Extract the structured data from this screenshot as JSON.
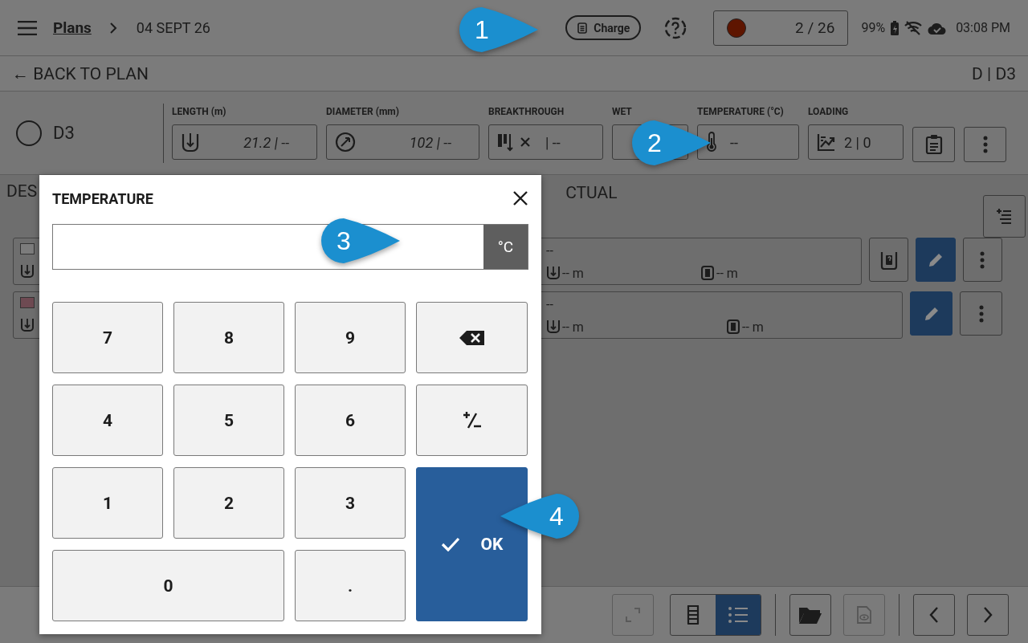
{
  "top_bar": {
    "breadcrumb": "Plans",
    "date": "04 SEPT 26",
    "charge_button": "Charge",
    "count": "2 / 26",
    "battery": "99%",
    "time": "03:08 PM"
  },
  "sub_bar": {
    "back": "← BACK TO PLAN",
    "location": "D | D3"
  },
  "hole": {
    "name": "D3",
    "fields": [
      {
        "label": "LENGTH (m)",
        "value": "21.2 | --",
        "kind": "length"
      },
      {
        "label": "DIAMETER (mm)",
        "value": "102 | --",
        "kind": "diameter"
      },
      {
        "label": "BREAKTHROUGH",
        "value": "|  --",
        "kind": "breakthrough"
      },
      {
        "label": "WET",
        "kind": "wet"
      },
      {
        "label": "TEMPERATURE (°C)",
        "value": "--",
        "kind": "temperature"
      },
      {
        "label": "LOADING",
        "value": "2 | 0",
        "kind": "loading"
      }
    ]
  },
  "section_titles": [
    "DES",
    "CTUAL"
  ],
  "rows": [
    {
      "color": "#7c7c7c",
      "value": "--",
      "length": "-- m",
      "depth": "-- m",
      "charge_button": true
    },
    {
      "color": "#6e4a52",
      "value": "--",
      "length": "-- m",
      "depth": "-- m",
      "charge_button": false
    }
  ],
  "view_tabs": [
    {
      "kind": "column",
      "selected": false
    },
    {
      "kind": "list",
      "selected": true
    }
  ],
  "dialog": {
    "title": "TEMPERATURE",
    "unit": "°C",
    "keys": [
      {
        "kind": "digit",
        "label": "7"
      },
      {
        "kind": "digit",
        "label": "8"
      },
      {
        "kind": "digit",
        "label": "9"
      },
      {
        "kind": "backspace"
      },
      {
        "kind": "digit",
        "label": "4"
      },
      {
        "kind": "digit",
        "label": "5"
      },
      {
        "kind": "digit",
        "label": "6"
      },
      {
        "kind": "sign"
      },
      {
        "kind": "digit",
        "label": "1"
      },
      {
        "kind": "digit",
        "label": "2"
      },
      {
        "kind": "digit",
        "label": "3"
      },
      {
        "kind": "ok",
        "label": "OK"
      },
      {
        "kind": "zero",
        "label": "0"
      },
      {
        "kind": "digit",
        "label": "."
      }
    ]
  },
  "callouts": [
    {
      "label": "1",
      "kind": "right"
    },
    {
      "label": "2",
      "kind": "right"
    },
    {
      "label": "3",
      "kind": "right"
    },
    {
      "label": "4",
      "kind": "left"
    }
  ]
}
